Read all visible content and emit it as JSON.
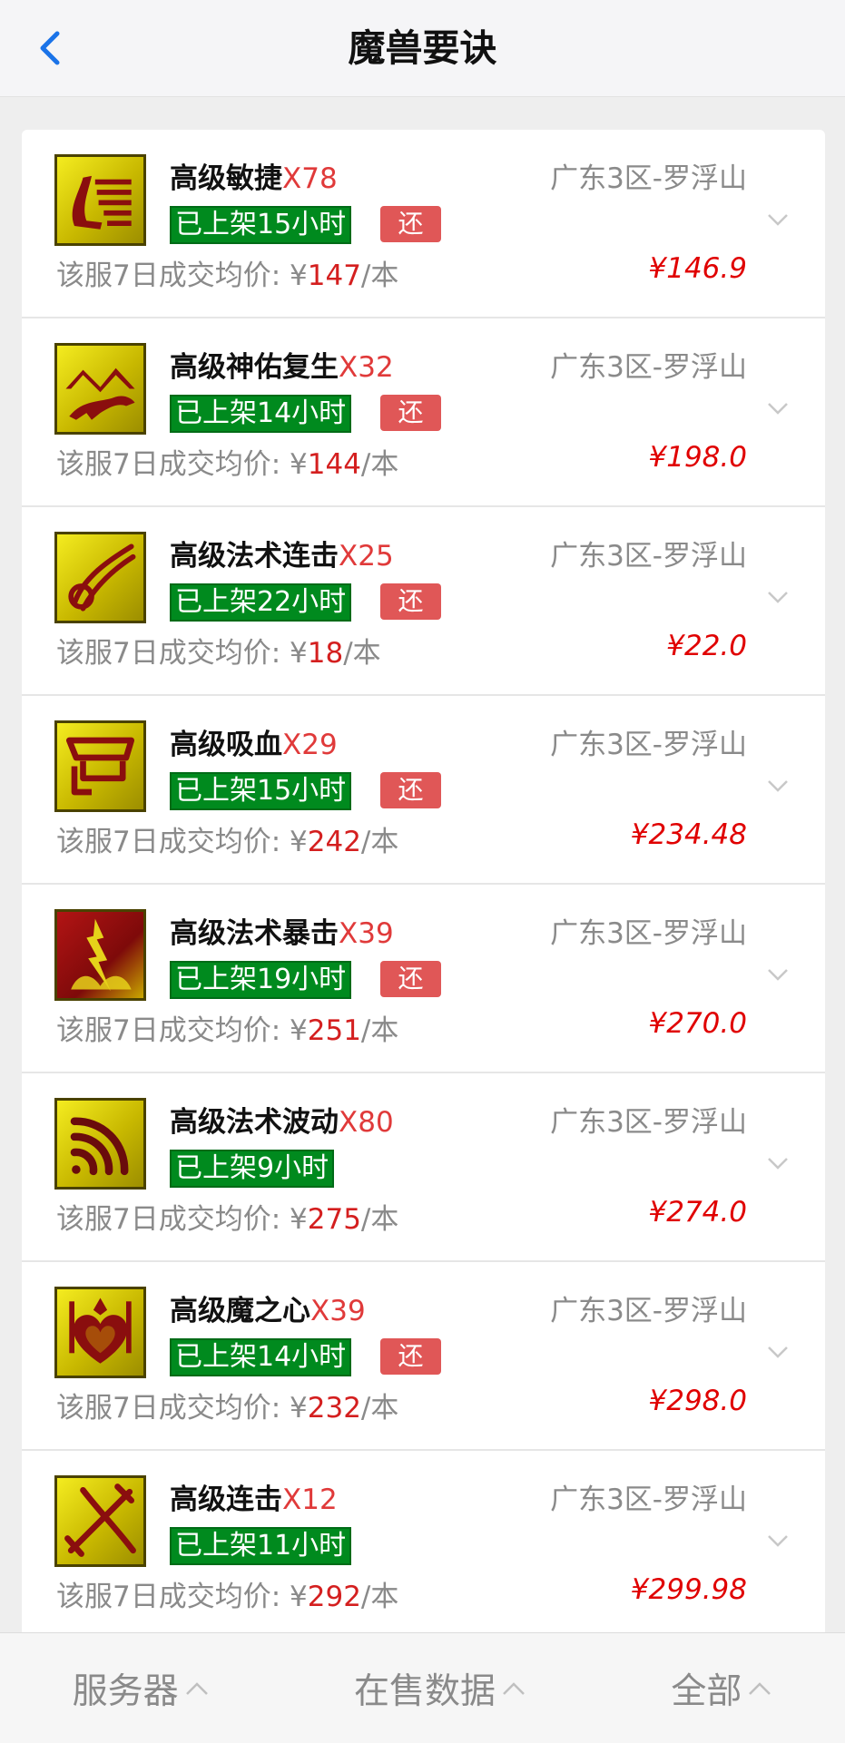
{
  "header": {
    "title": "魔兽要诀",
    "back_icon": "chevron-left-icon"
  },
  "items": [
    {
      "name": "高级敏捷",
      "qty": "X78",
      "server": "广东3区-罗浮山",
      "listed": "已上架15小时",
      "badge": "还",
      "avg_label": "该服7日成交均价: ¥",
      "avg_price": "147",
      "avg_unit": "/本",
      "price": "¥146.9",
      "icon": "agility-icon"
    },
    {
      "name": "高级神佑复生",
      "qty": "X32",
      "server": "广东3区-罗浮山",
      "listed": "已上架14小时",
      "badge": "还",
      "avg_label": "该服7日成交均价: ¥",
      "avg_price": "144",
      "avg_unit": "/本",
      "price": "¥198.0",
      "icon": "divine-revival-icon"
    },
    {
      "name": "高级法术连击",
      "qty": "X25",
      "server": "广东3区-罗浮山",
      "listed": "已上架22小时",
      "badge": "还",
      "avg_label": "该服7日成交均价: ¥",
      "avg_price": "18",
      "avg_unit": "/本",
      "price": "¥22.0",
      "icon": "spell-combo-icon"
    },
    {
      "name": "高级吸血",
      "qty": "X29",
      "server": "广东3区-罗浮山",
      "listed": "已上架15小时",
      "badge": "还",
      "avg_label": "该服7日成交均价: ¥",
      "avg_price": "242",
      "avg_unit": "/本",
      "price": "¥234.48",
      "icon": "lifesteal-icon"
    },
    {
      "name": "高级法术暴击",
      "qty": "X39",
      "server": "广东3区-罗浮山",
      "listed": "已上架19小时",
      "badge": "还",
      "avg_label": "该服7日成交均价: ¥",
      "avg_price": "251",
      "avg_unit": "/本",
      "price": "¥270.0",
      "icon": "spell-critical-icon"
    },
    {
      "name": "高级法术波动",
      "qty": "X80",
      "server": "广东3区-罗浮山",
      "listed": "已上架9小时",
      "badge": "",
      "avg_label": "该服7日成交均价: ¥",
      "avg_price": "275",
      "avg_unit": "/本",
      "price": "¥274.0",
      "icon": "spell-wave-icon"
    },
    {
      "name": "高级魔之心",
      "qty": "X39",
      "server": "广东3区-罗浮山",
      "listed": "已上架14小时",
      "badge": "还",
      "avg_label": "该服7日成交均价: ¥",
      "avg_price": "232",
      "avg_unit": "/本",
      "price": "¥298.0",
      "icon": "magic-heart-icon"
    },
    {
      "name": "高级连击",
      "qty": "X12",
      "server": "广东3区-罗浮山",
      "listed": "已上架11小时",
      "badge": "",
      "avg_label": "该服7日成交均价: ¥",
      "avg_price": "292",
      "avg_unit": "/本",
      "price": "¥299.98",
      "icon": "combo-icon"
    }
  ],
  "footer": {
    "tabs": [
      {
        "label": "服务器"
      },
      {
        "label": "在售数据"
      },
      {
        "label": "全部"
      }
    ]
  },
  "colors": {
    "accent": "#1a73e8",
    "listed_bg": "#008a1e",
    "badge_bg": "#e05757",
    "price": "#e00000"
  }
}
